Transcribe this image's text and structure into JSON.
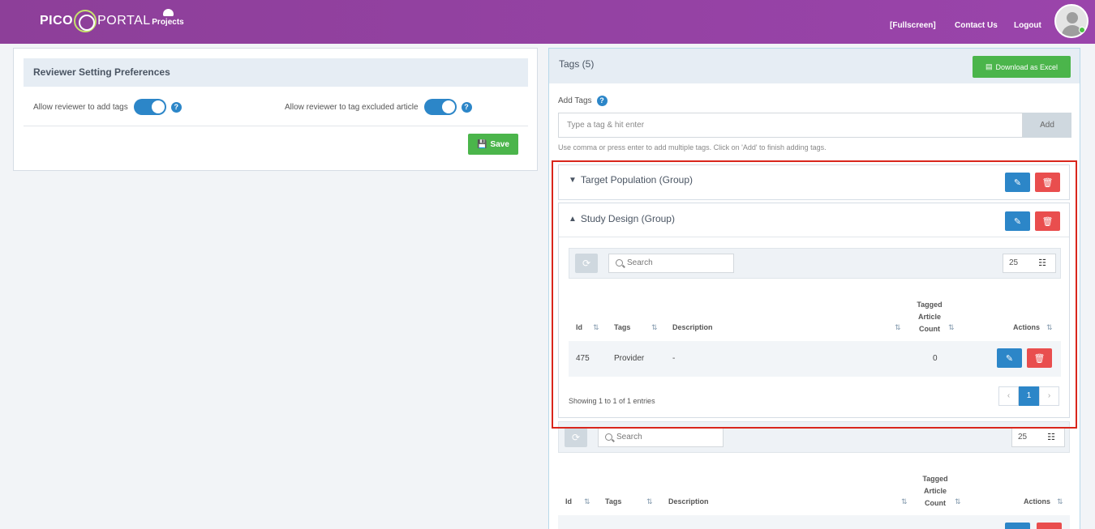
{
  "header": {
    "logo_left": "PICO",
    "logo_right": "PORTAL",
    "projects_label": "Projects",
    "fullscreen_label": "Fullscreen",
    "contact_label": "Contact Us",
    "logout_label": "Logout"
  },
  "preferences": {
    "title": "Reviewer Setting Preferences",
    "add_tags_label": "Allow reviewer to add tags",
    "excluded_label": "Allow reviewer to tag excluded article",
    "add_tags_enabled": true,
    "excluded_enabled": true,
    "save_label": "Save"
  },
  "tags": {
    "title": "Tags (5)",
    "download_label": "Download as Excel",
    "add_label": "Add Tags",
    "input_placeholder": "Type a tag & hit enter",
    "add_button": "Add",
    "hint": "Use comma or press enter to add multiple tags. Click on 'Add' to finish adding tags."
  },
  "groups": [
    {
      "title": "Target Population (Group)",
      "expanded": false
    },
    {
      "title": "Study Design (Group)",
      "expanded": true
    }
  ],
  "table": {
    "search_placeholder": "Search",
    "page_size": "25",
    "columns": {
      "id": "Id",
      "tags": "Tags",
      "description": "Description",
      "count_1": "Tagged",
      "count_2": "Article",
      "count_3": "Count",
      "actions": "Actions"
    },
    "rows": [
      {
        "id": "475",
        "tag": "Provider",
        "description": "-",
        "count": "0"
      }
    ],
    "showing": "Showing 1 to 1 of 1 entries",
    "pages": [
      "‹",
      "1",
      "›"
    ]
  },
  "colors": {
    "header": "#9a44ab",
    "primary": "#2c86c8",
    "success": "#4bb54b",
    "danger": "#e94e4e",
    "highlight": "#d9261c"
  }
}
